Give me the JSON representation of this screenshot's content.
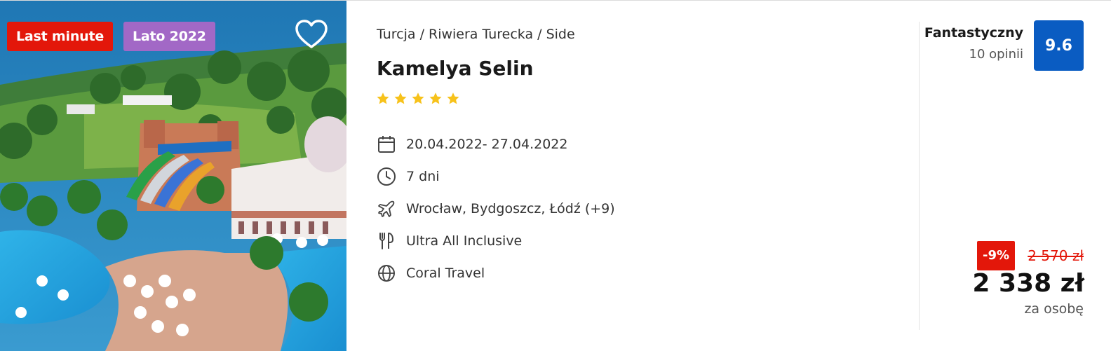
{
  "offer": {
    "badges": {
      "last_minute": "Last minute",
      "season": "Lato 2022"
    },
    "breadcrumb": "Turcja / Riwiera Turecka / Side",
    "hotel_name": "Kamelya Selin",
    "stars": 5,
    "facts": {
      "dates": "20.04.2022- 27.04.2022",
      "duration": "7 dni",
      "departure": "Wrocław, Bydgoszcz, Łódź  (+9)",
      "board": "Ultra All Inclusive",
      "operator": "Coral Travel"
    },
    "rating": {
      "label": "Fantastyczny",
      "count": "10 opinii",
      "score": "9.6"
    },
    "price": {
      "discount": "-9%",
      "old": "2 570 zł",
      "current": "2 338 zł",
      "per": "za osobę"
    }
  },
  "icons": {
    "favorite": "heart-outline-icon",
    "star": "star-icon",
    "dates": "calendar-icon",
    "duration": "clock-icon",
    "departure": "airplane-icon",
    "board": "cutlery-icon",
    "operator": "globe-icon"
  },
  "colors": {
    "last_minute": "#e3170a",
    "season": "#a268c6",
    "score_bg": "#0a5cc2",
    "star": "#f7c21b",
    "discount": "#e3170a"
  }
}
